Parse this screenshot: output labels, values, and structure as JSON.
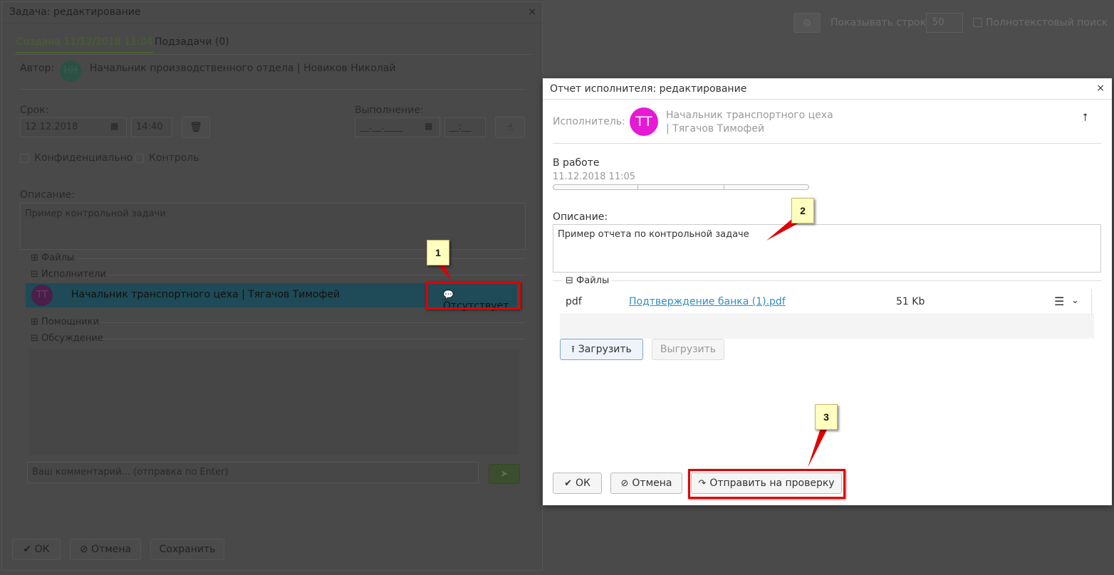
{
  "background": {
    "show_rows_label": "Показывать строк",
    "show_rows_value": "50",
    "fulltext_label": "Полнотекстовый поиск"
  },
  "task_dialog": {
    "title": "Задача: редактирование",
    "close": "×",
    "tabs": [
      "Создана 11/12/2018 11:04",
      "Подзадачи (0)"
    ],
    "author_label": "Автор:",
    "author_initials": "НН",
    "author_name": "Начальник производственного отдела | Новиков Николай",
    "deadline_label": "Срок:",
    "deadline_date": "12.12.2018",
    "deadline_time": "14:40",
    "completion_label": "Выполнение:",
    "completion_date_placeholder": "__.__.____",
    "completion_time_placeholder": "__:__",
    "confidential_label": "Конфиденциально",
    "control_label": "Контроль",
    "description_label": "Описание:",
    "description_value": "Пример контрольной задачи",
    "sections": {
      "files": "Файлы",
      "executors": "Исполнители",
      "helpers": "Помощники",
      "discussion": "Обсуждение"
    },
    "executor": {
      "initials": "ТТ",
      "name": "Начальник транспортного цеха | Тягачов Тимофей",
      "status": "Отсутствует"
    },
    "comment_placeholder": "Ваш комментарий... (отправка по  Enter)",
    "buttons": {
      "ok": "ОК",
      "cancel": "Отмена",
      "save": "Сохранить"
    }
  },
  "report_dialog": {
    "title": "Отчет исполнителя: редактирование",
    "close": "×",
    "executor_label": "Исполнитель:",
    "executor_initials": "ТТ",
    "executor_position": "Начальник транспортного цеха",
    "executor_name": "| Тягачов Тимофей",
    "status": "В работе",
    "status_date": "11.12.2018 11:05",
    "description_label": "Описание:",
    "description_value": "Пример отчета по контрольной задаче",
    "files_label": "Файлы",
    "file": {
      "type": "pdf",
      "name": "Подтверждение банка (1).pdf",
      "size": "51 Kb"
    },
    "upload_label": "Загрузить",
    "download_label": "Выгрузить",
    "buttons": {
      "ok": "ОК",
      "cancel": "Отмена",
      "send": "Отправить на проверку"
    }
  },
  "callouts": [
    "1",
    "2",
    "3"
  ],
  "colors": {
    "accent_red": "#e00000",
    "avatar_magenta": "#e619d4",
    "link_blue": "#2f8fbf"
  }
}
